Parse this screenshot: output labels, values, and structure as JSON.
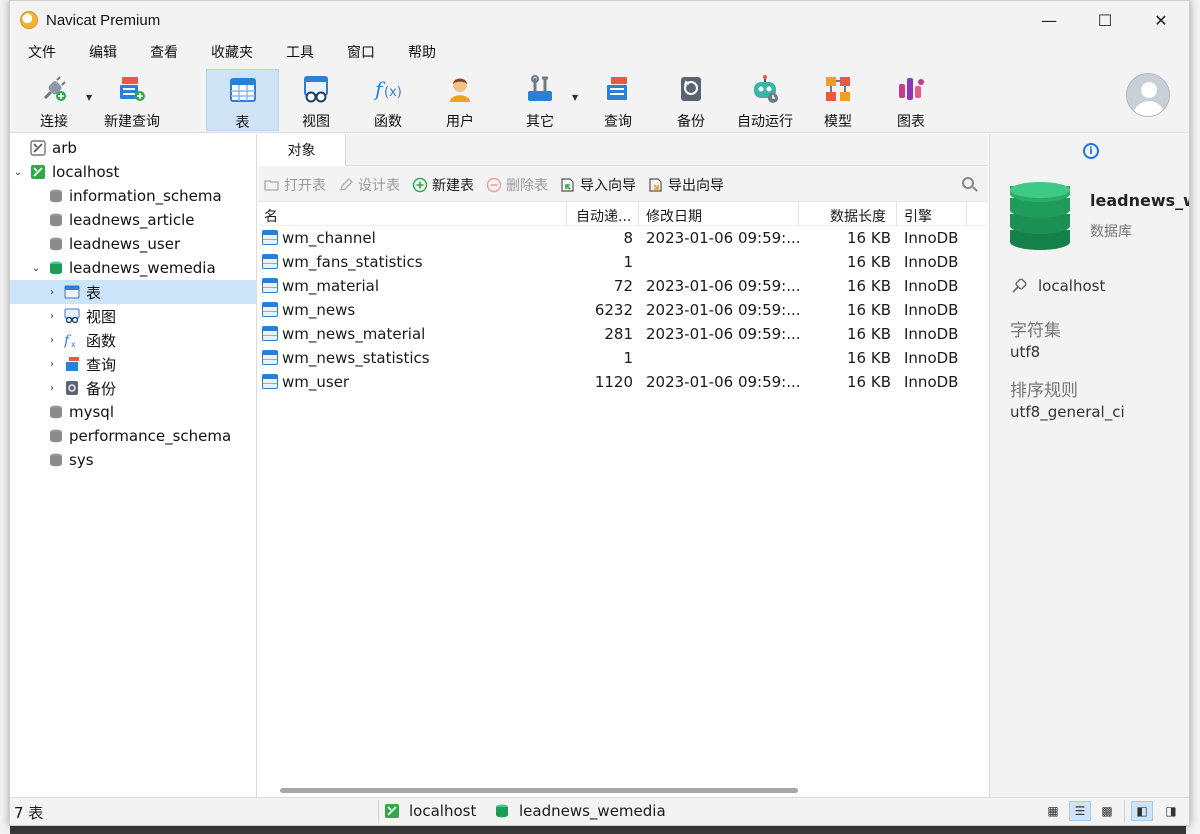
{
  "window": {
    "title": "Navicat Premium"
  },
  "menu": [
    "文件",
    "编辑",
    "查看",
    "收藏夹",
    "工具",
    "窗口",
    "帮助"
  ],
  "toolbar": {
    "connect": "连接",
    "new_query": "新建查询",
    "table": "表",
    "view": "视图",
    "function": "函数",
    "user": "用户",
    "other": "其它",
    "query": "查询",
    "backup": "备份",
    "automation": "自动运行",
    "model": "模型",
    "chart": "图表"
  },
  "tree": {
    "arb": "arb",
    "localhost": "localhost",
    "dbs": [
      "information_schema",
      "leadnews_article",
      "leadnews_user"
    ],
    "open_db": "leadnews_wemedia",
    "children": [
      "表",
      "视图",
      "函数",
      "查询",
      "备份"
    ],
    "dbs_after": [
      "mysql",
      "performance_schema",
      "sys"
    ]
  },
  "tabs": {
    "objects": "对象"
  },
  "object_toolbar": {
    "open_table": "打开表",
    "design_table": "设计表",
    "new_table": "新建表",
    "delete_table": "删除表",
    "import_wizard": "导入向导",
    "export_wizard": "导出向导"
  },
  "grid": {
    "headers": {
      "name": "名",
      "auto_inc": "自动递...",
      "modified": "修改日期",
      "data_length": "数据长度",
      "engine": "引擎"
    },
    "rows": [
      {
        "name": "wm_channel",
        "auto_inc": "8",
        "modified": "2023-01-06 09:59:...",
        "data_length": "16 KB",
        "engine": "InnoDB"
      },
      {
        "name": "wm_fans_statistics",
        "auto_inc": "1",
        "modified": "",
        "data_length": "16 KB",
        "engine": "InnoDB"
      },
      {
        "name": "wm_material",
        "auto_inc": "72",
        "modified": "2023-01-06 09:59:...",
        "data_length": "16 KB",
        "engine": "InnoDB"
      },
      {
        "name": "wm_news",
        "auto_inc": "6232",
        "modified": "2023-01-06 09:59:...",
        "data_length": "16 KB",
        "engine": "InnoDB"
      },
      {
        "name": "wm_news_material",
        "auto_inc": "281",
        "modified": "2023-01-06 09:59:...",
        "data_length": "16 KB",
        "engine": "InnoDB"
      },
      {
        "name": "wm_news_statistics",
        "auto_inc": "1",
        "modified": "",
        "data_length": "16 KB",
        "engine": "InnoDB"
      },
      {
        "name": "wm_user",
        "auto_inc": "1120",
        "modified": "2023-01-06 09:59:...",
        "data_length": "16 KB",
        "engine": "InnoDB"
      }
    ]
  },
  "info": {
    "db_name": "leadnews_w",
    "db_type": "数据库",
    "connection": "localhost",
    "charset_label": "字符集",
    "charset_value": "utf8",
    "collation_label": "排序规则",
    "collation_value": "utf8_general_ci"
  },
  "status": {
    "count": "7 表",
    "connection": "localhost",
    "database": "leadnews_wemedia"
  }
}
